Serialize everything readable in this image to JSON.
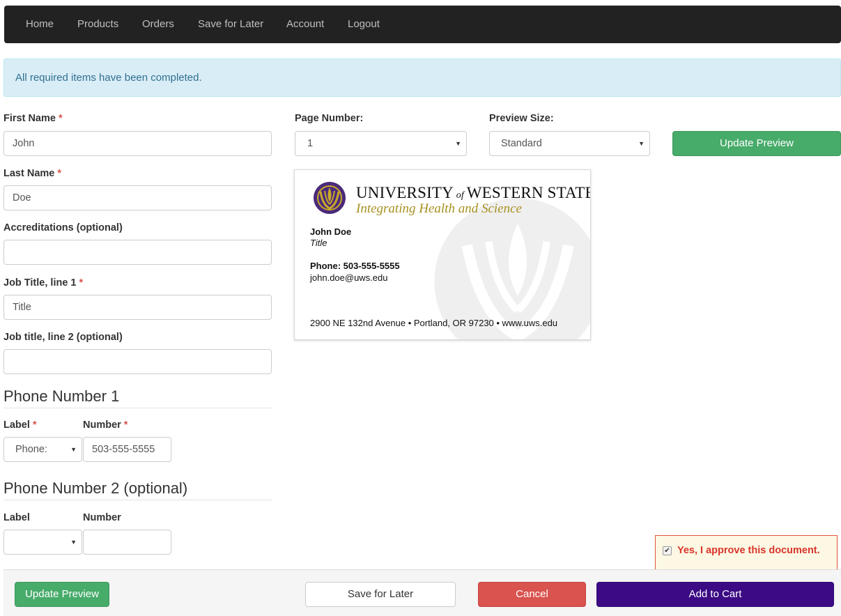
{
  "nav": {
    "items": [
      "Home",
      "Products",
      "Orders",
      "Save for Later",
      "Account",
      "Logout"
    ]
  },
  "alert": {
    "message": "All required items have been completed."
  },
  "form": {
    "first_name": {
      "label": "First Name",
      "required": "*",
      "value": "John"
    },
    "last_name": {
      "label": "Last Name",
      "required": "*",
      "value": "Doe"
    },
    "accreditations": {
      "label": "Accreditations (optional)",
      "value": ""
    },
    "job_title_1": {
      "label": "Job Title, line 1",
      "required": "*",
      "value": "Title"
    },
    "job_title_2": {
      "label": "Job title, line 2 (optional)",
      "value": ""
    },
    "phone1": {
      "heading": "Phone Number 1",
      "label_label": "Label",
      "label_required": "*",
      "number_label": "Number",
      "number_required": "*",
      "label_value": "Phone:",
      "number_value": "503-555-5555"
    },
    "phone2": {
      "heading": "Phone Number 2 (optional)",
      "label_label": "Label",
      "number_label": "Number",
      "label_value": "",
      "number_value": ""
    }
  },
  "preview": {
    "page_number_label": "Page Number:",
    "page_number_value": "1",
    "preview_size_label": "Preview Size:",
    "preview_size_value": "Standard",
    "update_button": "Update Preview"
  },
  "card": {
    "university": "UNIVERSITY of WESTERN STATES",
    "university_main_1": "UNIVERSITY",
    "university_of": "of",
    "university_main_2": "WESTERN STATES",
    "tagline": "Integrating Health and Science",
    "name": "John Doe",
    "title": "Title",
    "phone": "Phone: 503-555-5555",
    "email": "john.doe@uws.edu",
    "address": "2900 NE 132nd Avenue • Portland, OR 97230 • www.uws.edu"
  },
  "approve": {
    "label": "Yes, I approve this document.",
    "checked": true
  },
  "footer": {
    "update_preview": "Update Preview",
    "save_for_later": "Save for Later",
    "cancel": "Cancel",
    "add_to_cart": "Add to Cart"
  },
  "colors": {
    "navbar": "#222222",
    "success": "#47ab6a",
    "danger": "#d9534f",
    "primary_purple": "#3b0a84",
    "brand_purple": "#4b2a7a",
    "brand_gold": "#a8901f",
    "alert_bg": "#d9edf7"
  }
}
